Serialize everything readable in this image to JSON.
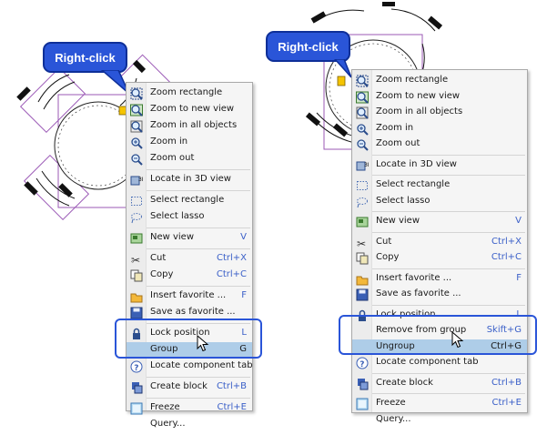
{
  "callout_label": "Right-click",
  "left_menu": {
    "items": [
      {
        "label": "Zoom rectangle",
        "shortcut": "",
        "icon": "zoom-rectangle-icon"
      },
      {
        "label": "Zoom to new view",
        "shortcut": "",
        "icon": "zoom-new-view-icon"
      },
      {
        "label": "Zoom in all objects",
        "shortcut": "",
        "icon": "zoom-all-objects-icon"
      },
      {
        "label": "Zoom in",
        "shortcut": "",
        "icon": "zoom-in-icon"
      },
      {
        "label": "Zoom out",
        "shortcut": "",
        "icon": "zoom-out-icon"
      },
      {
        "label": "Locate in 3D view",
        "shortcut": "",
        "icon": "locate-3d-icon"
      },
      {
        "label": "Select rectangle",
        "shortcut": "",
        "icon": "select-rectangle-icon"
      },
      {
        "label": "Select lasso",
        "shortcut": "",
        "icon": "select-lasso-icon"
      },
      {
        "label": "New view",
        "shortcut": "V",
        "icon": "new-view-icon"
      },
      {
        "label": "Cut",
        "shortcut": "Ctrl+X",
        "icon": "scissors-icon"
      },
      {
        "label": "Copy",
        "shortcut": "Ctrl+C",
        "icon": "copy-icon"
      },
      {
        "label": "Insert favorite ...",
        "shortcut": "F",
        "icon": "insert-favorite-icon"
      },
      {
        "label": "Save as favorite ...",
        "shortcut": "",
        "icon": "save-icon"
      },
      {
        "label": "Lock position",
        "shortcut": "L",
        "icon": "lock-icon"
      },
      {
        "label": "Group",
        "shortcut": "G",
        "icon": ""
      },
      {
        "label": "Locate component tab",
        "shortcut": "",
        "icon": "help-icon"
      },
      {
        "label": "Create block",
        "shortcut": "Ctrl+B",
        "icon": "create-block-icon"
      },
      {
        "label": "Freeze",
        "shortcut": "Ctrl+E",
        "icon": "freeze-icon"
      },
      {
        "label": "Query...",
        "shortcut": "",
        "icon": ""
      }
    ]
  },
  "right_menu": {
    "items": [
      {
        "label": "Zoom rectangle",
        "shortcut": "",
        "icon": "zoom-rectangle-icon"
      },
      {
        "label": "Zoom to new view",
        "shortcut": "",
        "icon": "zoom-new-view-icon"
      },
      {
        "label": "Zoom in all objects",
        "shortcut": "",
        "icon": "zoom-all-objects-icon"
      },
      {
        "label": "Zoom in",
        "shortcut": "",
        "icon": "zoom-in-icon"
      },
      {
        "label": "Zoom out",
        "shortcut": "",
        "icon": "zoom-out-icon"
      },
      {
        "label": "Locate in 3D view",
        "shortcut": "",
        "icon": "locate-3d-icon"
      },
      {
        "label": "Select rectangle",
        "shortcut": "",
        "icon": "select-rectangle-icon"
      },
      {
        "label": "Select lasso",
        "shortcut": "",
        "icon": "select-lasso-icon"
      },
      {
        "label": "New view",
        "shortcut": "V",
        "icon": "new-view-icon"
      },
      {
        "label": "Cut",
        "shortcut": "Ctrl+X",
        "icon": "scissors-icon"
      },
      {
        "label": "Copy",
        "shortcut": "Ctrl+C",
        "icon": "copy-icon"
      },
      {
        "label": "Insert favorite ...",
        "shortcut": "F",
        "icon": "insert-favorite-icon"
      },
      {
        "label": "Save as favorite ...",
        "shortcut": "",
        "icon": "save-icon"
      },
      {
        "label": "Lock position",
        "shortcut": "L",
        "icon": "lock-icon"
      },
      {
        "label": "Remove from group",
        "shortcut": "Skift+G",
        "icon": ""
      },
      {
        "label": "Ungroup",
        "shortcut": "Ctrl+G",
        "icon": ""
      },
      {
        "label": "Locate component tab",
        "shortcut": "",
        "icon": "help-icon"
      },
      {
        "label": "Create block",
        "shortcut": "Ctrl+B",
        "icon": "create-block-icon"
      },
      {
        "label": "Freeze",
        "shortcut": "Ctrl+E",
        "icon": "freeze-icon"
      },
      {
        "label": "Query...",
        "shortcut": "",
        "icon": ""
      }
    ]
  },
  "colors": {
    "accent": "#2a55d8",
    "highlight": "#aecde8",
    "shortcut": "#3a5fc8",
    "selection_outline": "#9b59b6"
  }
}
